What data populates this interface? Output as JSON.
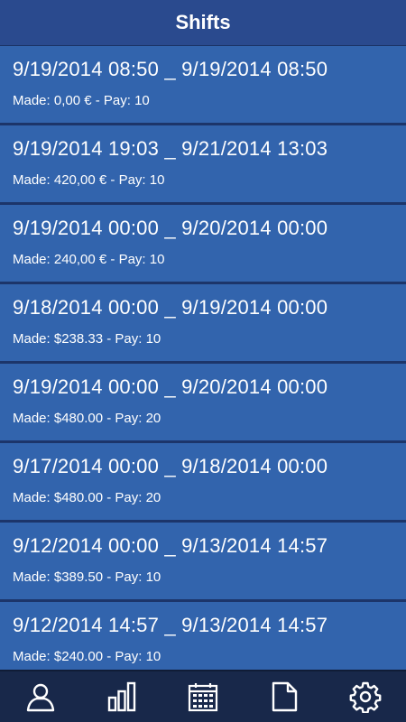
{
  "header": {
    "title": "Shifts"
  },
  "shifts": [
    {
      "range": "9/19/2014 08:50 _ 9/19/2014 08:50",
      "summary": "Made: 0,00 € - Pay: 10"
    },
    {
      "range": "9/19/2014 19:03 _ 9/21/2014 13:03",
      "summary": "Made: 420,00 € - Pay: 10"
    },
    {
      "range": "9/19/2014 00:00 _ 9/20/2014 00:00",
      "summary": "Made: 240,00 € - Pay: 10"
    },
    {
      "range": "9/18/2014 00:00 _ 9/19/2014 00:00",
      "summary": "Made: $238.33 - Pay: 10"
    },
    {
      "range": "9/19/2014 00:00 _ 9/20/2014 00:00",
      "summary": "Made: $480.00 - Pay: 20"
    },
    {
      "range": "9/17/2014 00:00 _ 9/18/2014 00:00",
      "summary": "Made: $480.00 - Pay: 20"
    },
    {
      "range": "9/12/2014 00:00 _ 9/13/2014 14:57",
      "summary": "Made: $389.50 - Pay: 10"
    },
    {
      "range": "9/12/2014 14:57 _ 9/13/2014 14:57",
      "summary": "Made: $240.00 - Pay: 10"
    }
  ],
  "tabbar": {
    "icons": [
      "person-icon",
      "bar-chart-icon",
      "calendar-icon",
      "document-icon",
      "gear-icon"
    ]
  },
  "colors": {
    "header": "#2a4a8e",
    "row": "#3264ad",
    "divider": "#1c356a",
    "tabbar": "#18284a"
  }
}
